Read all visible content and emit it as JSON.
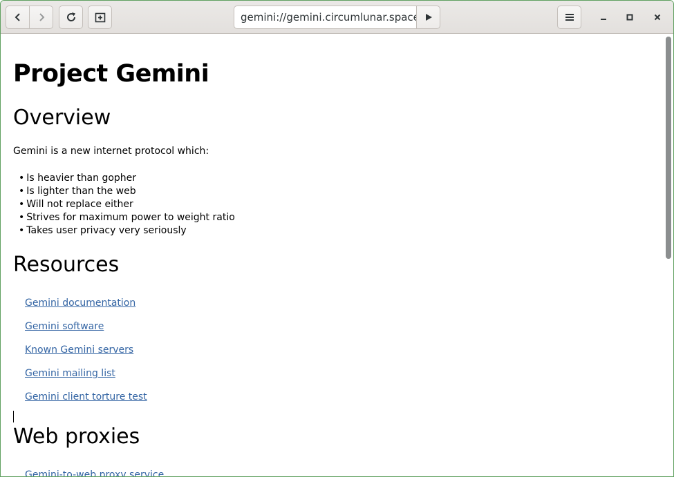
{
  "toolbar": {
    "back_icon": "chevron-left-icon",
    "forward_icon": "chevron-right-icon",
    "reload_icon": "reload-icon",
    "new_tab_icon": "new-tab-icon",
    "go_icon": "play-icon",
    "menu_icon": "hamburger-menu-icon",
    "url": "gemini://gemini.circumlunar.space/"
  },
  "window_controls": {
    "minimize_icon": "minimize-icon",
    "maximize_icon": "maximize-icon",
    "close_icon": "close-icon"
  },
  "page": {
    "title": "Project Gemini",
    "overview": {
      "heading": "Overview",
      "intro": "Gemini is a new internet protocol which:",
      "bullets": [
        "Is heavier than gopher",
        "Is lighter than the web",
        "Will not replace either",
        "Strives for maximum power to weight ratio",
        "Takes user privacy very seriously"
      ]
    },
    "resources": {
      "heading": "Resources",
      "links": [
        "Gemini documentation",
        "Gemini software",
        "Known Gemini servers",
        "Gemini mailing list",
        "Gemini client torture test"
      ]
    },
    "web_proxies": {
      "heading": "Web proxies",
      "links": [
        "Gemini-to-web proxy service"
      ]
    }
  },
  "colors": {
    "link": "#3465a4",
    "window_border": "#5fa05f",
    "headerbar": "#e8e6e3"
  }
}
